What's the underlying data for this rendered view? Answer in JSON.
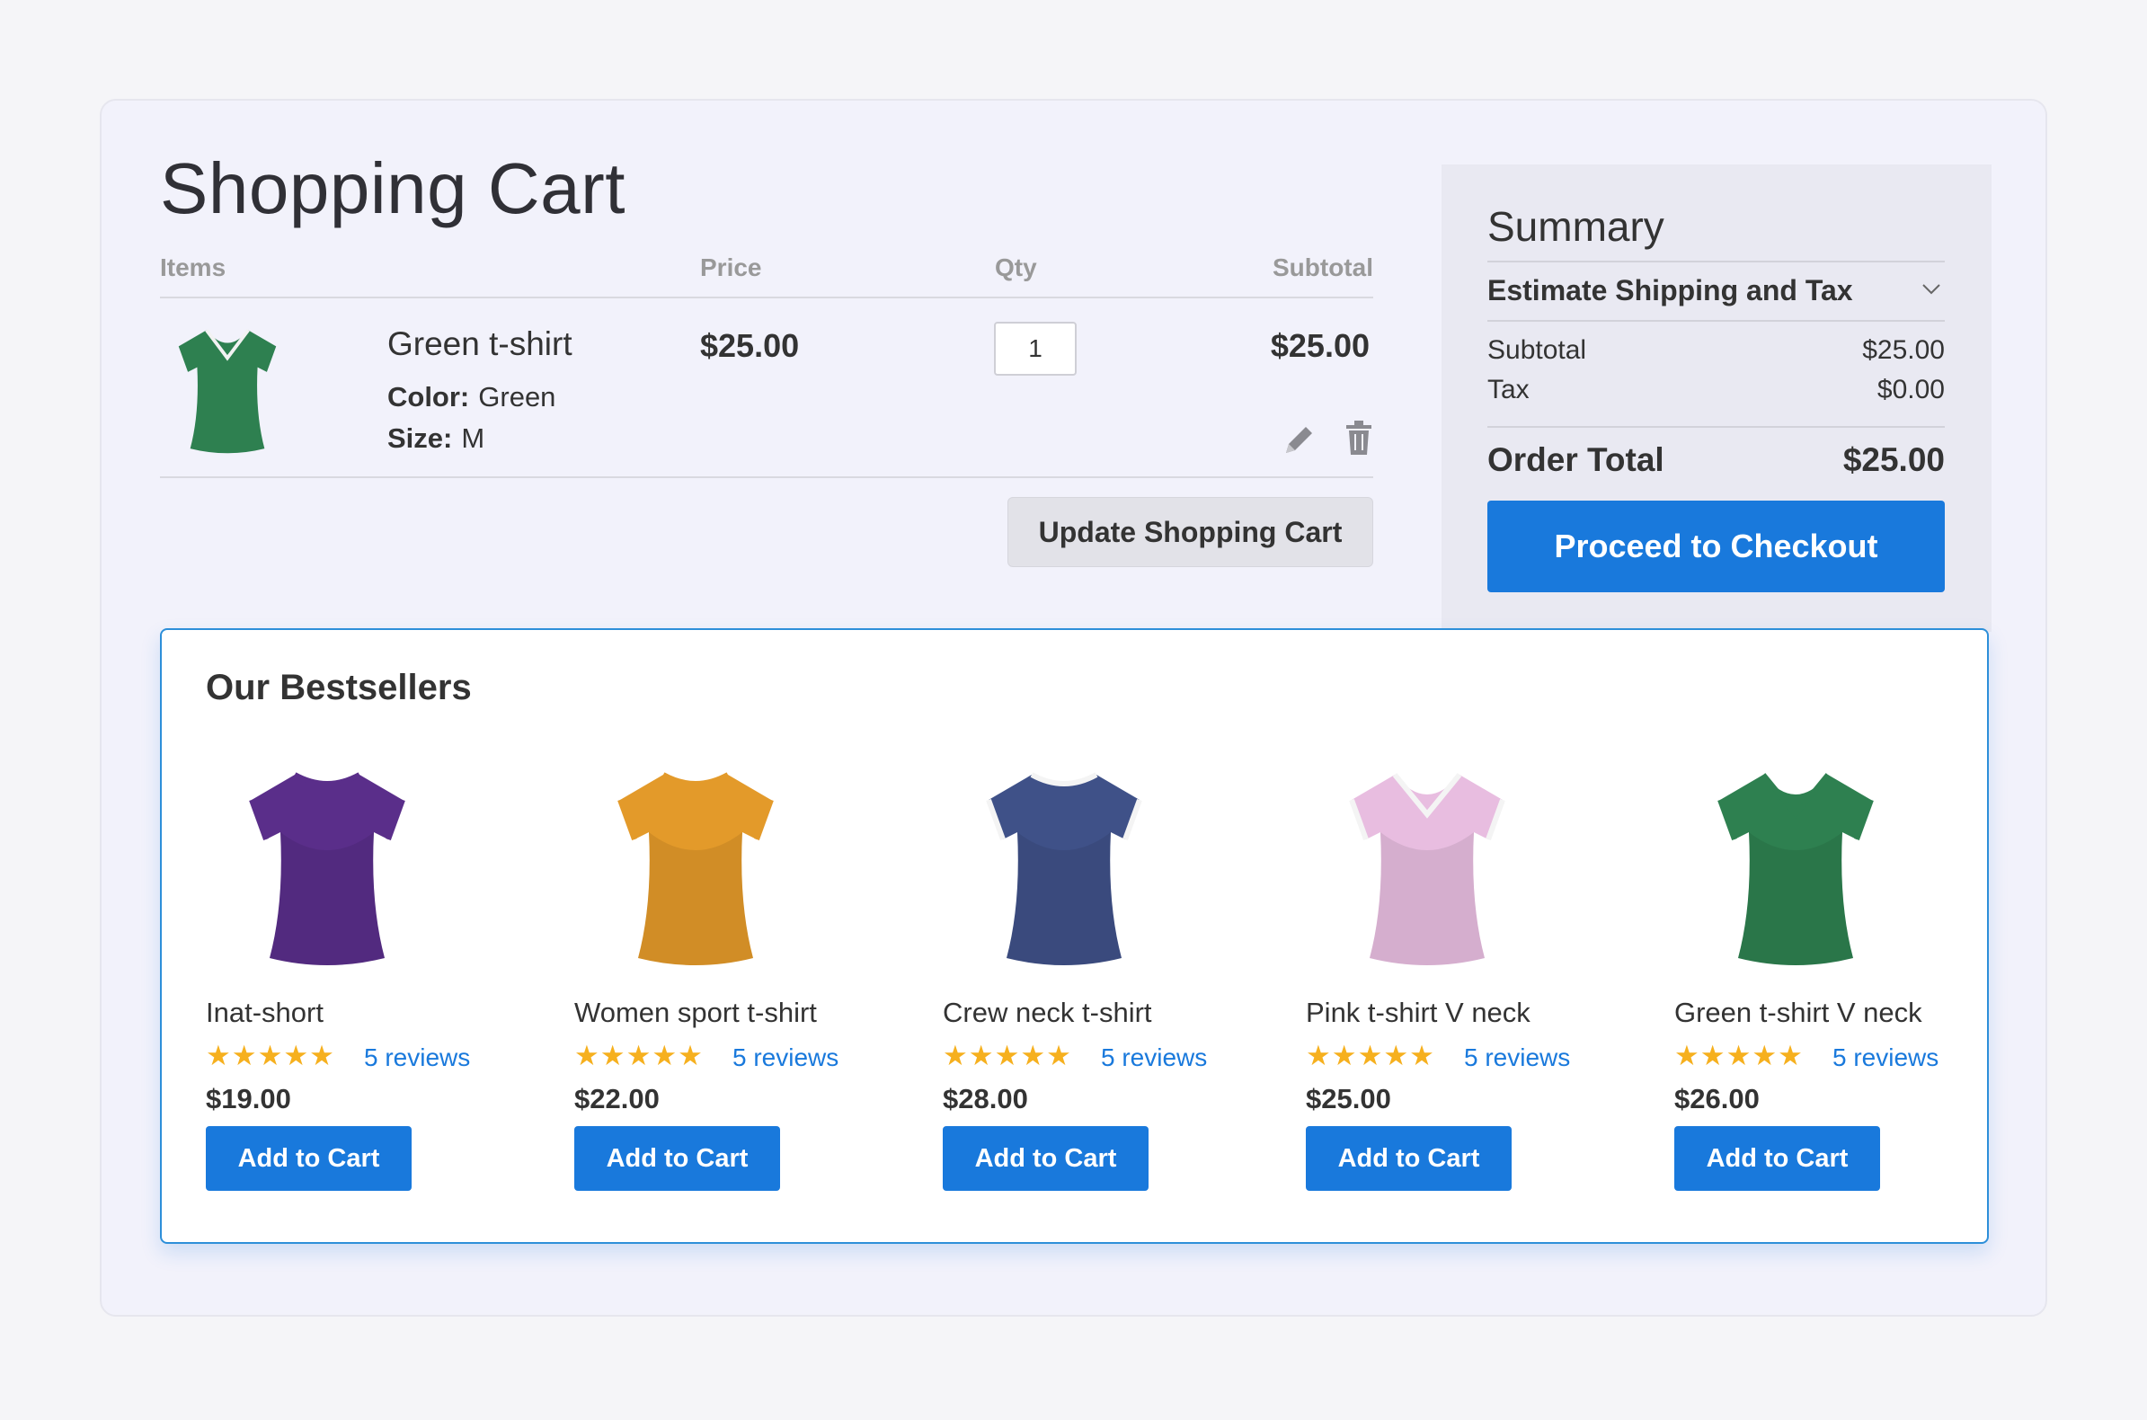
{
  "cart": {
    "title": "Shopping Cart",
    "columns": {
      "items": "Items",
      "price": "Price",
      "qty": "Qty",
      "subtotal": "Subtotal"
    },
    "item": {
      "name": "Green t-shirt",
      "color_label": "Color:",
      "color_value": "Green",
      "size_label": "Size:",
      "size_value": "M",
      "price": "$25.00",
      "qty": "1",
      "subtotal": "$25.00",
      "shirt_color": "#2e8050"
    },
    "update_label": "Update Shopping Cart"
  },
  "summary": {
    "title": "Summary",
    "estimate_label": "Estimate Shipping and Tax",
    "subtotal_label": "Subtotal",
    "subtotal_value": "$25.00",
    "tax_label": "Tax",
    "tax_value": "$0.00",
    "order_total_label": "Order Total",
    "order_total_value": "$25.00",
    "checkout_label": "Proceed to Checkout"
  },
  "bestsellers": {
    "title": "Our Bestsellers",
    "products": [
      {
        "name": "Inat-short",
        "stars": "★★★★★",
        "reviews": "5 reviews",
        "price": "$19.00",
        "button": "Add to Cart",
        "color": "#5a2e8a",
        "trim": "#5a2e8a",
        "neck": "crew"
      },
      {
        "name": "Women sport t-shirt",
        "stars": "★★★★★",
        "reviews": "5 reviews",
        "price": "$22.00",
        "button": "Add to Cart",
        "color": "#e39a2a",
        "trim": "#e39a2a",
        "neck": "crew"
      },
      {
        "name": "Crew neck t-shirt",
        "stars": "★★★★★",
        "reviews": "5 reviews",
        "price": "$28.00",
        "button": "Add to Cart",
        "color": "#3f5188",
        "trim": "#f4f4f4",
        "neck": "crew"
      },
      {
        "name": "Pink t-shirt V neck",
        "stars": "★★★★★",
        "reviews": "5 reviews",
        "price": "$25.00",
        "button": "Add to Cart",
        "color": "#e8bde0",
        "trim": "#f4f4f4",
        "neck": "v"
      },
      {
        "name": "Green t-shirt V neck",
        "stars": "★★★★★",
        "reviews": "5 reviews",
        "price": "$26.00",
        "button": "Add to Cart",
        "color": "#2e8050",
        "trim": "#2e8050",
        "neck": "v"
      }
    ]
  },
  "icons": {
    "edit": "pencil-icon",
    "delete": "trash-icon",
    "expand": "chevron-down-icon"
  }
}
